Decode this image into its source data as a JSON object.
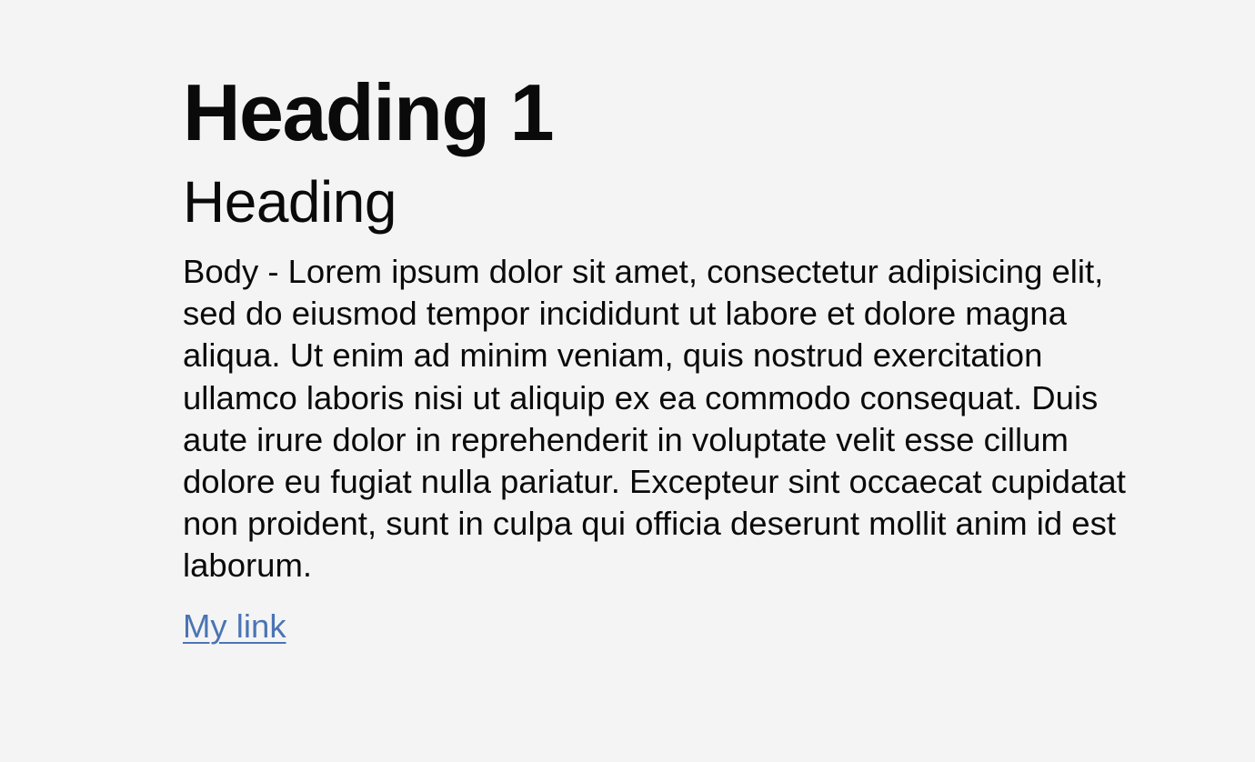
{
  "content": {
    "heading1": "Heading 1",
    "heading2": "Heading",
    "body": "Body - Lorem ipsum dolor sit amet, consectetur adipisicing elit, sed do eiusmod tempor incididunt ut labore et dolore magna aliqua. Ut enim ad minim veniam, quis nostrud exercitation ullamco laboris nisi ut aliquip ex ea commodo consequat. Duis aute irure dolor in reprehenderit in voluptate velit esse cillum dolore eu fugiat nulla pariatur. Excepteur sint occaecat cupidatat non proident, sunt in culpa qui officia deserunt mollit anim id est laborum.",
    "link_label": "My link"
  },
  "colors": {
    "background": "#f4f4f4",
    "text": "#0a0a0a",
    "link": "#4a74b4"
  }
}
